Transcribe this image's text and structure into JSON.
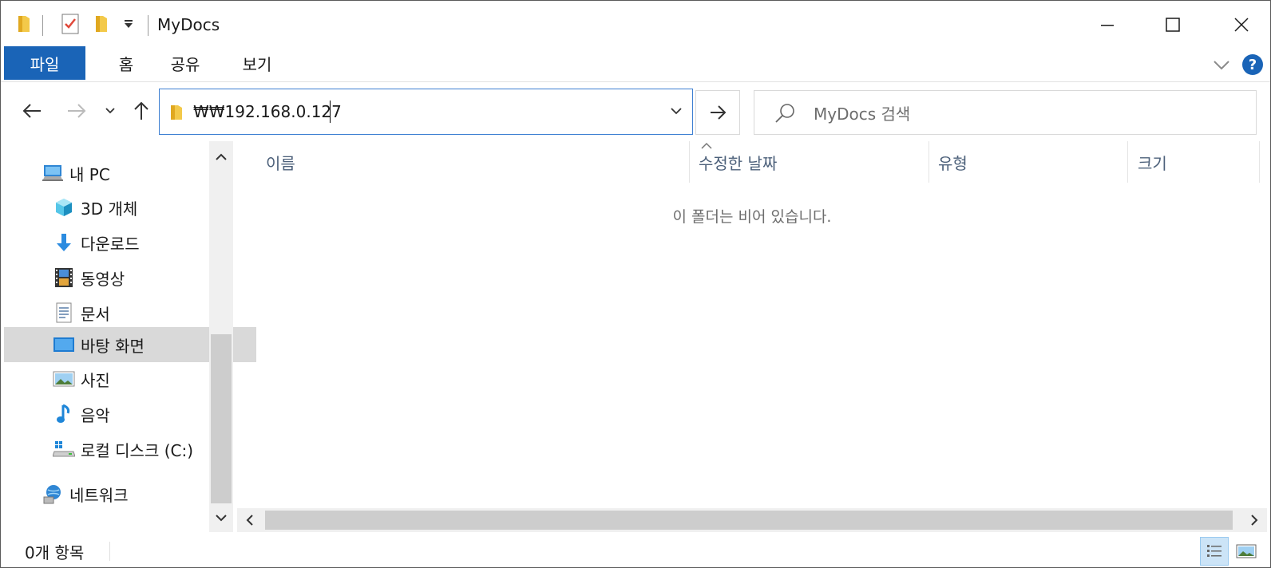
{
  "window": {
    "title": "MyDocs"
  },
  "ribbon": {
    "tabs": [
      {
        "label": "파일",
        "active": true
      },
      {
        "label": "홈"
      },
      {
        "label": "공유"
      },
      {
        "label": "보기"
      }
    ],
    "accent_color": "#1a64b7"
  },
  "address": {
    "path": "₩₩192.168.0.127"
  },
  "search": {
    "placeholder": "MyDocs 검색"
  },
  "nav": {
    "items": [
      {
        "label": "내 PC",
        "icon": "this-pc-icon",
        "level": 0
      },
      {
        "label": "3D 개체",
        "icon": "3d-objects-icon",
        "level": 1
      },
      {
        "label": "다운로드",
        "icon": "download-icon",
        "level": 1
      },
      {
        "label": "동영상",
        "icon": "video-icon",
        "level": 1
      },
      {
        "label": "문서",
        "icon": "document-icon",
        "level": 1
      },
      {
        "label": "바탕 화면",
        "icon": "desktop-icon",
        "level": 1,
        "selected": true
      },
      {
        "label": "사진",
        "icon": "pictures-icon",
        "level": 1
      },
      {
        "label": "음악",
        "icon": "music-icon",
        "level": 1
      },
      {
        "label": "로컬 디스크 (C:)",
        "icon": "local-disk-icon",
        "level": 1
      },
      {
        "label": "네트워크",
        "icon": "network-icon",
        "level": 0
      }
    ]
  },
  "content": {
    "columns": [
      "이름",
      "수정한 날짜",
      "유형",
      "크기"
    ],
    "empty_message": "이 폴더는 비어 있습니다."
  },
  "status": {
    "item_count": "0개 항목"
  }
}
